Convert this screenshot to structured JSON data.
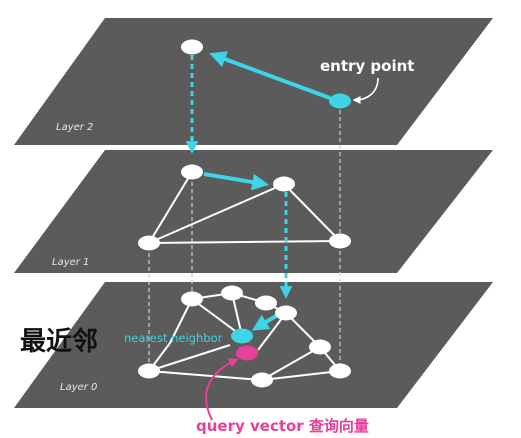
{
  "layers": [
    {
      "id": "layer2",
      "label": "Layer 2"
    },
    {
      "id": "layer1",
      "label": "Layer 1"
    },
    {
      "id": "layer0",
      "label": "Layer  0"
    }
  ],
  "labels": {
    "entry_point": "entry point",
    "nearest_neighbor": "nearest neighbor",
    "query_vector": "query vector 查询向量",
    "nearest_cn": "最近邻"
  },
  "colors": {
    "plane": "#5b5b5b",
    "node": "#ffffff",
    "edge": "#ffffff",
    "path": "#3fd3e6",
    "query": "#e6409a",
    "guide": "#cfcfcf"
  },
  "graph": {
    "layer2": {
      "nodes": [
        "n2a",
        "n2b"
      ],
      "edges": [],
      "path": [
        [
          "n2b",
          "n2a"
        ]
      ]
    },
    "layer1": {
      "nodes": [
        "n1a",
        "n1b",
        "n1c",
        "n1d"
      ],
      "edges": [
        [
          "n1a",
          "n1b"
        ],
        [
          "n1a",
          "n1c"
        ],
        [
          "n1c",
          "n1b"
        ],
        [
          "n1b",
          "n1d"
        ],
        [
          "n1c",
          "n1d"
        ]
      ],
      "path": [
        [
          "n1a",
          "n1b"
        ]
      ]
    },
    "layer0": {
      "nodes": [
        "n0a",
        "n0b",
        "n0c",
        "n0d",
        "n0e",
        "n0f",
        "n0g",
        "n0h",
        "n0i",
        "n0j"
      ],
      "edges": [
        [
          "n0a",
          "n0b"
        ],
        [
          "n0b",
          "n0c"
        ],
        [
          "n0c",
          "n0d"
        ],
        [
          "n0a",
          "n0f"
        ],
        [
          "n0b",
          "n0e"
        ],
        [
          "n0c",
          "n0e"
        ],
        [
          "n0d",
          "n0e"
        ],
        [
          "n0f",
          "n0e"
        ],
        [
          "n0d",
          "n0g"
        ],
        [
          "n0g",
          "n0h"
        ],
        [
          "n0f",
          "n0i"
        ],
        [
          "n0i",
          "n0h"
        ],
        [
          "n0i",
          "n0j"
        ],
        [
          "n0j",
          "n0h"
        ],
        [
          "n0g",
          "n0j"
        ]
      ],
      "path": [
        [
          "n0d",
          "n0e"
        ]
      ]
    },
    "inter_layer": [
      [
        "n2a",
        "n1a"
      ],
      [
        "n1b",
        "n0d"
      ]
    ],
    "guides": [
      [
        "n2b",
        "n1d"
      ],
      [
        "n1d",
        "n0h"
      ],
      [
        "n1c",
        "n0f"
      ],
      [
        "n1a",
        "n0b"
      ]
    ]
  }
}
